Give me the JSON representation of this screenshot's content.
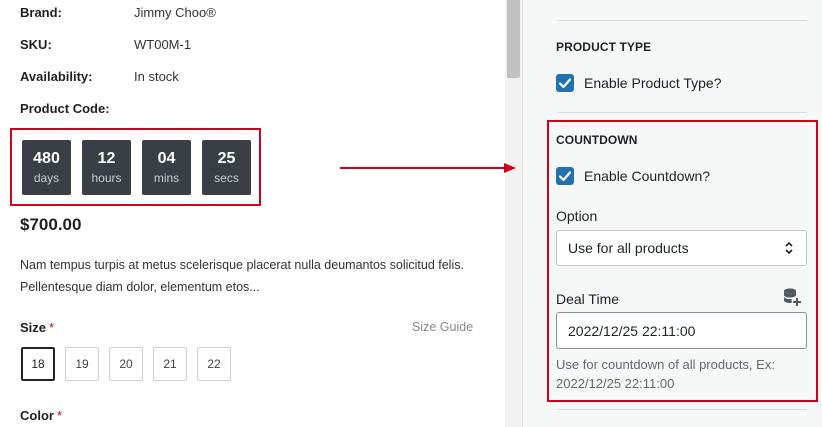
{
  "product": {
    "meta": [
      {
        "label": "Brand:",
        "value": "Jimmy Choo®"
      },
      {
        "label": "SKU:",
        "value": "WT00M-1"
      },
      {
        "label": "Availability:",
        "value": "In stock"
      },
      {
        "label": "Product Code:",
        "value": ""
      }
    ],
    "countdown": [
      {
        "value": "480",
        "unit": "days"
      },
      {
        "value": "12",
        "unit": "hours"
      },
      {
        "value": "04",
        "unit": "mins"
      },
      {
        "value": "25",
        "unit": "secs"
      }
    ],
    "price": "$700.00",
    "description_line1": "Nam tempus turpis at metus scelerisque placerat nulla deumantos solicitud felis.",
    "description_line2": "Pellentesque diam dolor, elementum etos...",
    "size_label": "Size",
    "required_mark": "*",
    "size_guide": "Size Guide",
    "sizes": [
      "18",
      "19",
      "20",
      "21",
      "22"
    ],
    "selected_size": "18",
    "color_label": "Color"
  },
  "settings": {
    "product_type": {
      "title": "PRODUCT TYPE",
      "checkbox_label": "Enable Product Type?",
      "checked": true
    },
    "countdown": {
      "title": "COUNTDOWN",
      "checkbox_label": "Enable Countdown?",
      "checked": true,
      "option_label": "Option",
      "option_value": "Use for all products",
      "deal_time_label": "Deal Time",
      "deal_time_value": "2022/12/25 22:11:00",
      "help_text": "Use for countdown of all products, Ex: 2022/12/25 22:11:00"
    }
  },
  "colors": {
    "highlight": "#d0021b",
    "checkbox": "#2271b1",
    "countdown_bg": "#3a3f45"
  },
  "icons": {
    "arrow": "arrow-right-icon",
    "checkbox": "checkmark-icon",
    "select": "chevron-updown-icon",
    "deal_time": "database-add-icon"
  }
}
